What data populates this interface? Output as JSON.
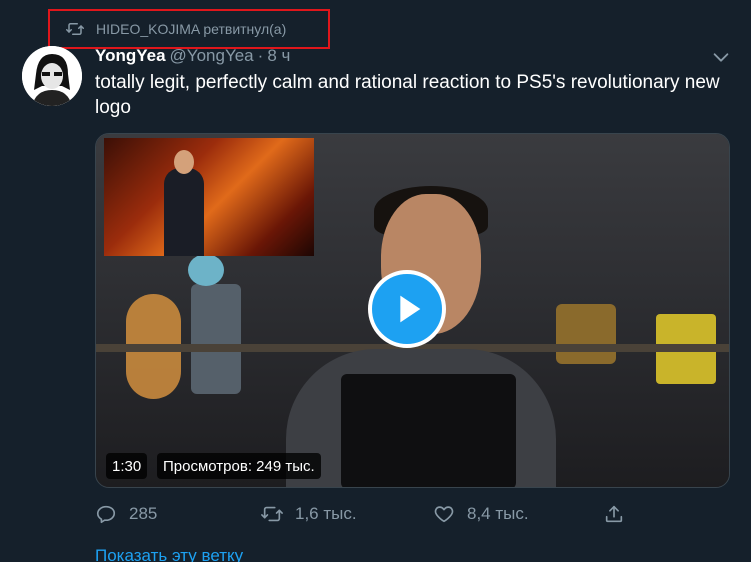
{
  "retweet": {
    "label": "HIDEO_KOJIMA ретвитнул(а)",
    "icon": "retweet-icon"
  },
  "tweet": {
    "name": "YongYea",
    "handle": "@YongYea",
    "separator": "·",
    "time": "8 ч",
    "text": "totally legit, perfectly calm and rational reaction to PS5's revolutionary new logo"
  },
  "media": {
    "duration": "1:30",
    "views": "Просмотров: 249 тыс."
  },
  "actions": {
    "reply_count": "285",
    "retweet_count": "1,6 тыс.",
    "like_count": "8,4 тыс.",
    "share_label": ""
  },
  "footer": {
    "show_thread": "Показать эту ветку"
  },
  "colors": {
    "background": "#15202b",
    "accent": "#1da1f2",
    "muted": "#8899a6",
    "highlight": "#e0161b"
  }
}
